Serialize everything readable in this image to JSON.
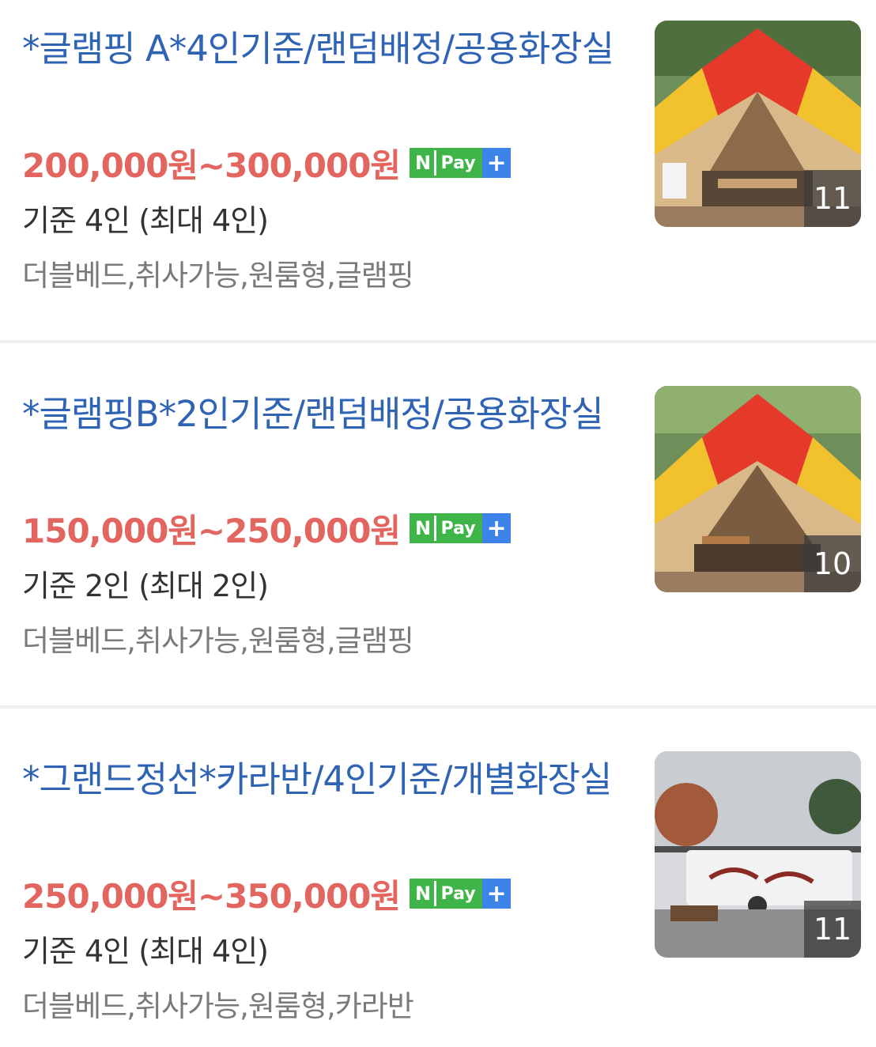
{
  "listings": [
    {
      "title": "*글램핑 A*4인기준/랜덤배정/공용화장실",
      "price": "200,000원~300,000원",
      "npay": {
        "n": "N",
        "pay": "Pay",
        "plus": "+"
      },
      "capacity": "기준 4인 (최대 4인)",
      "features": "더블베드,취사가능,원룸형,글램핑",
      "photo_count": "11",
      "image": "glamping-tent-photo"
    },
    {
      "title": "*글램핑B*2인기준/랜덤배정/공용화장실",
      "price": "150,000원~250,000원",
      "npay": {
        "n": "N",
        "pay": "Pay",
        "plus": "+"
      },
      "capacity": "기준 2인 (최대 2인)",
      "features": "더블베드,취사가능,원룸형,글램핑",
      "photo_count": "10",
      "image": "glamping-tent-photo"
    },
    {
      "title": "*그랜드정선*카라반/4인기준/개별화장실",
      "price": "250,000원~350,000원",
      "npay": {
        "n": "N",
        "pay": "Pay",
        "plus": "+"
      },
      "capacity": "기준 4인 (최대 4인)",
      "features": "더블베드,취사가능,원룸형,카라반",
      "photo_count": "11",
      "image": "caravan-photo"
    }
  ],
  "colors": {
    "title": "#2f63b4",
    "price": "#e2655f",
    "npay_green": "#3fb549",
    "npay_blue": "#3d83ea"
  }
}
